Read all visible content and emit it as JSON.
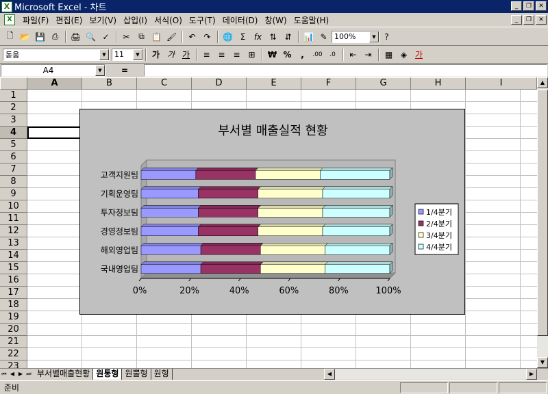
{
  "window": {
    "title": "Microsoft Excel - 차트"
  },
  "menu": [
    "파일(F)",
    "편집(E)",
    "보기(V)",
    "삽입(I)",
    "서식(O)",
    "도구(T)",
    "데이터(D)",
    "창(W)",
    "도움말(H)"
  ],
  "toolbar": {
    "zoom": "100%"
  },
  "format": {
    "font": "돋움",
    "size": "11"
  },
  "formula": {
    "cell_ref": "A4",
    "eq": "="
  },
  "grid": {
    "columns": [
      "A",
      "B",
      "C",
      "D",
      "E",
      "F",
      "G",
      "H",
      "I"
    ],
    "rows": [
      "1",
      "2",
      "3",
      "4",
      "5",
      "6",
      "7",
      "8",
      "9",
      "10",
      "11",
      "12",
      "13",
      "14",
      "15",
      "16",
      "17",
      "18",
      "19",
      "20",
      "21",
      "22",
      "23"
    ],
    "active_col": "A",
    "active_row": "4"
  },
  "chart_data": {
    "type": "bar",
    "orientation": "horizontal",
    "stacked": "percent",
    "title": "부서별 매출실적 현황",
    "categories": [
      "국내영업팀",
      "해외영업팀",
      "경영정보팀",
      "투자정보팀",
      "기획운영팀",
      "고객지원팀"
    ],
    "series": [
      {
        "name": "1/4분기",
        "color": "#9999ff",
        "values": [
          24,
          24,
          23,
          23,
          23,
          22
        ]
      },
      {
        "name": "2/4분기",
        "color": "#993366",
        "values": [
          24,
          24,
          24,
          24,
          24,
          24
        ]
      },
      {
        "name": "3/4분기",
        "color": "#ffffcc",
        "values": [
          26,
          26,
          26,
          26,
          26,
          26
        ]
      },
      {
        "name": "4/4분기",
        "color": "#ccffff",
        "values": [
          26,
          26,
          27,
          27,
          27,
          28
        ]
      }
    ],
    "xlim": [
      0,
      100
    ],
    "x_ticks": [
      "0%",
      "20%",
      "40%",
      "60%",
      "80%",
      "100%"
    ],
    "legend": "right"
  },
  "sheets": {
    "tabs": [
      "부서별매출현황",
      "원통형",
      "원뿔형",
      "원형"
    ],
    "active": "원통형"
  },
  "status": {
    "text": "준비"
  }
}
